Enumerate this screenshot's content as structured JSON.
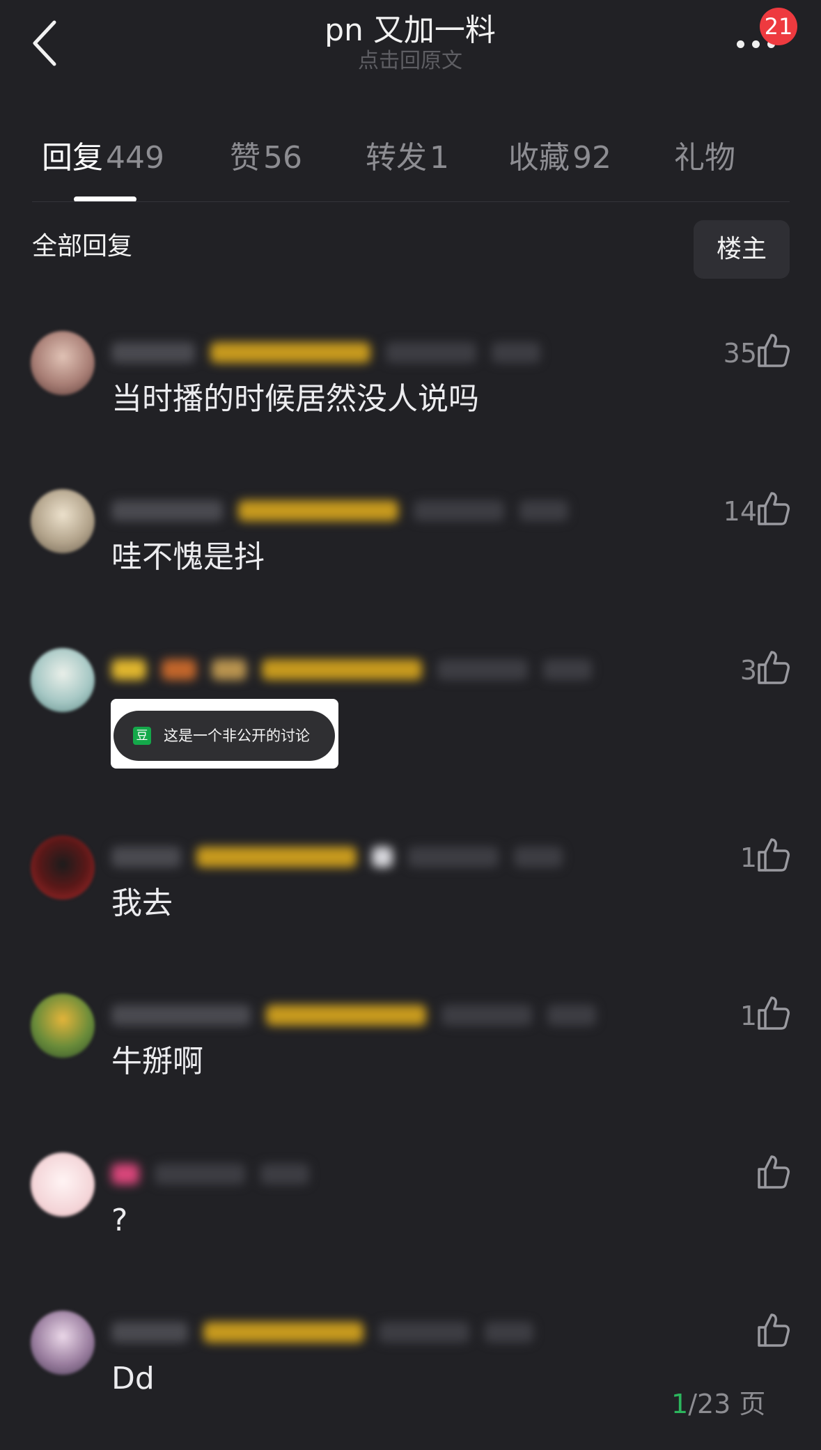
{
  "header": {
    "title": "pn 又加一料",
    "subtitle": "点击回原文",
    "notification_count": "21",
    "back_icon": "chevron-left-icon",
    "more_icon": "more-dots-icon"
  },
  "tabs": [
    {
      "name": "回复",
      "count": "449",
      "active": true
    },
    {
      "name": "赞",
      "count": "56",
      "active": false
    },
    {
      "name": "转发",
      "count": "1",
      "active": false
    },
    {
      "name": "收藏",
      "count": "92",
      "active": false
    },
    {
      "name": "礼物",
      "count": "",
      "active": false
    }
  ],
  "section": {
    "title": "全部回复",
    "filter_button": "楼主"
  },
  "comments": [
    {
      "text": "当时播的时候居然没人说吗",
      "likes": "35",
      "avatar_color": "#b98f86"
    },
    {
      "text": "哇不愧是抖",
      "likes": "14",
      "avatar_color": "#b3a48c"
    },
    {
      "text": "",
      "likes": "3",
      "avatar_color": "#a7c8c5"
    },
    {
      "text": "我去",
      "likes": "1",
      "avatar_color": "#8c2424"
    },
    {
      "text": "牛掰啊",
      "likes": "1",
      "avatar_color": "#3a6b3a"
    },
    {
      "text": "?",
      "likes": "",
      "avatar_color": "#f4d6d9"
    },
    {
      "text": "Dd",
      "likes": "",
      "avatar_color": "#9b7fa0"
    }
  ],
  "popup": {
    "logo_text": "豆",
    "message": "这是一个非公开的讨论"
  },
  "pagination": {
    "current": "1",
    "suffix": "/23 页"
  },
  "colors": {
    "background": "#212125",
    "accent_green": "#2cb65d",
    "badge_red": "#ee3a3f",
    "blurred_tag": "#c79a1e"
  }
}
